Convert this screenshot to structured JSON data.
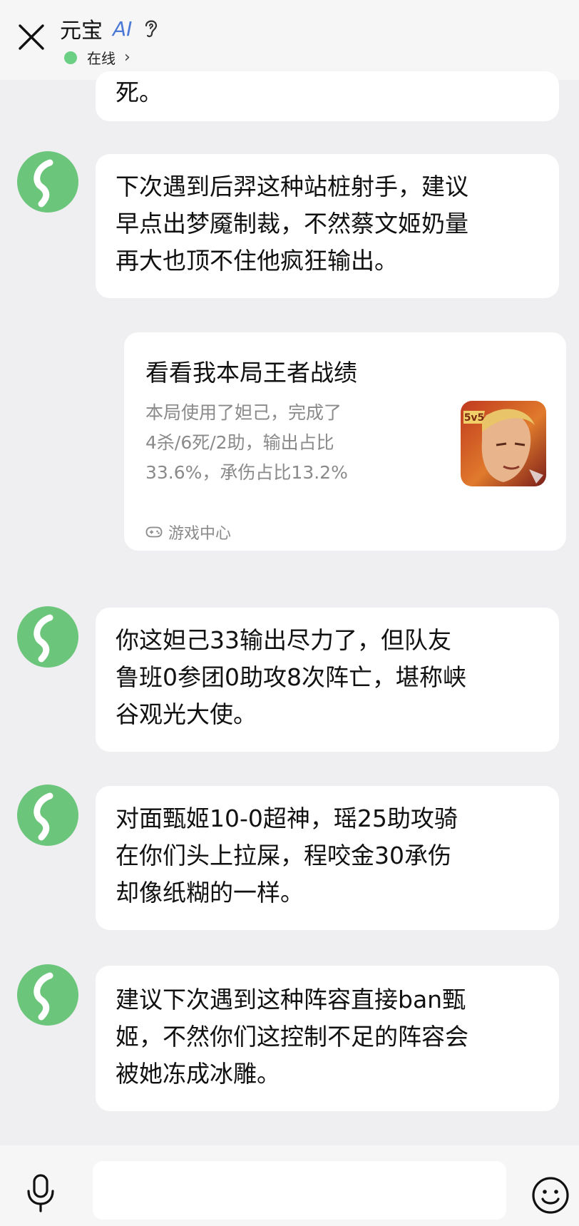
{
  "header": {
    "title": "元宝",
    "ai_tag": "AI",
    "status": "在线",
    "status_arrow": "›",
    "icons": [
      "close-icon",
      "ear-icon",
      "chevron-right-icon"
    ],
    "status_color": "#6bcf84"
  },
  "messages": [
    {
      "lines": [
        "死。"
      ]
    },
    {
      "lines": [
        "下次遇到后羿这种站桩射手，建议",
        "早点出梦魇制裁，不然蔡文姬奶量",
        "再大也顶不住他疯狂输出。"
      ]
    },
    {
      "lines": [
        "你这妲己33输出尽力了，但队友",
        "鲁班0参团0助攻8次阵亡，堪称峡",
        "谷观光大使。"
      ]
    },
    {
      "lines": [
        "对面甄姬10-0超神，瑶25助攻骑",
        "在你们头上拉屎，程咬金30承伤",
        "却像纸糊的一样。"
      ]
    },
    {
      "lines": [
        "建议下次遇到这种阵容直接ban甄",
        "姬，不然你们这控制不足的阵容会",
        "被她冻成冰雕。"
      ]
    }
  ],
  "card": {
    "title": "看看我本局王者战绩",
    "desc_lines": [
      "本局使用了妲己，完成了",
      "4杀/6死/2助，输出占比",
      "33.6%，承伤占比13.2%"
    ],
    "badge": "5v5",
    "source": "游戏中心",
    "icons": [
      "game-thumbnail",
      "gamepad-icon"
    ]
  },
  "input_bar": {
    "icons": [
      "microphone-icon",
      "emoji-icon"
    ]
  },
  "colors": {
    "background": "#efeff1",
    "bubble": "#ffffff",
    "avatar_green": "#6bc57a",
    "ai_blue": "#4b7ad6"
  }
}
